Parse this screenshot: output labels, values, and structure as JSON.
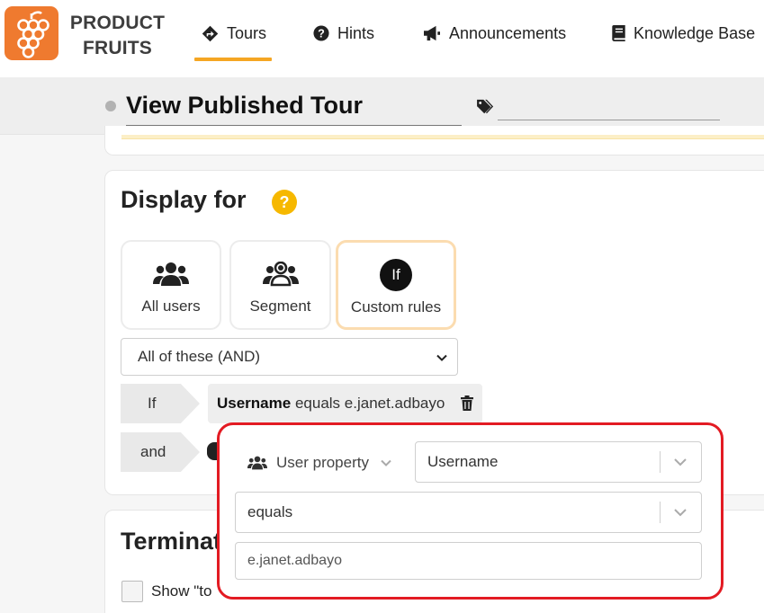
{
  "brand": {
    "name_line1": "PRODUCT",
    "name_line2": "FRUITS",
    "color": "#ef7a2f"
  },
  "nav": {
    "items": [
      {
        "label": "Tours",
        "icon": "diamond-arrow-icon",
        "active": true
      },
      {
        "label": "Hints",
        "icon": "question-circle-icon"
      },
      {
        "label": "Announcements",
        "icon": "megaphone-icon"
      },
      {
        "label": "Knowledge Base",
        "icon": "book-icon"
      }
    ],
    "active_color": "#f5a623"
  },
  "tour": {
    "title": "View Published Tour",
    "tags_value": ""
  },
  "display_for": {
    "title": "Display for",
    "help": "?",
    "options": [
      {
        "label": "All users",
        "icon": "users-icon"
      },
      {
        "label": "Segment",
        "icon": "user-group-icon"
      },
      {
        "label": "Custom rules",
        "icon": "if-icon",
        "badge": "If",
        "selected": true
      }
    ],
    "logic_select": "All of these (AND)",
    "rules": [
      {
        "connector": "If",
        "property": "Username",
        "operator": "equals",
        "value": "e.janet.adbayo"
      },
      {
        "connector": "and"
      }
    ]
  },
  "terminate": {
    "title": "Terminat",
    "checkbox_label": "Show \"to"
  },
  "rule_editor": {
    "property_type": "User property",
    "property": "Username",
    "operator": "equals",
    "value": "e.janet.adbayo",
    "highlight_color": "#e31b23"
  }
}
